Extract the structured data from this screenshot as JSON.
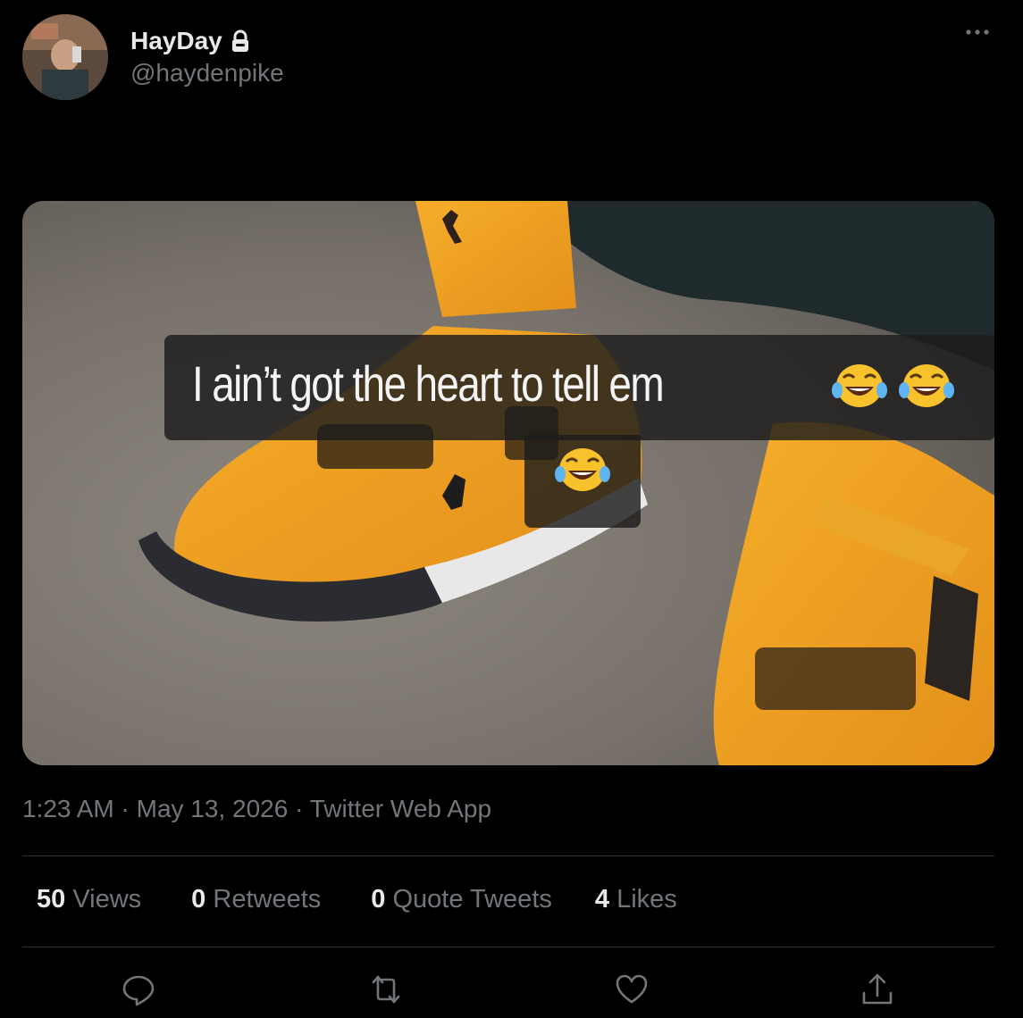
{
  "author": {
    "display_name": "HayDay",
    "handle": "@haydenpike",
    "protected_icon": "lock-icon"
  },
  "header": {
    "more_icon": "more-icon"
  },
  "media": {
    "caption_text": "I ain’t got the heart to tell em",
    "caption_emoji": [
      "😂",
      "😂",
      "😂"
    ]
  },
  "meta": {
    "time": "1:23 AM",
    "date": "May 13, 2026",
    "source": "Twitter Web App",
    "separator": "·"
  },
  "stats": {
    "views_count": "50",
    "views_label": "Views",
    "retweets_count": "0",
    "retweets_label": "Retweets",
    "quotes_count": "0",
    "quotes_label": "Quote Tweets",
    "likes_count": "4",
    "likes_label": "Likes"
  },
  "actions": [
    "reply-icon",
    "retweet-icon",
    "like-icon",
    "share-icon"
  ],
  "colors": {
    "background": "#000000",
    "primary_text": "#e7e9ea",
    "secondary_text": "#71767b",
    "divider": "#2f3336",
    "shoe_orange": "#f2a21e"
  }
}
